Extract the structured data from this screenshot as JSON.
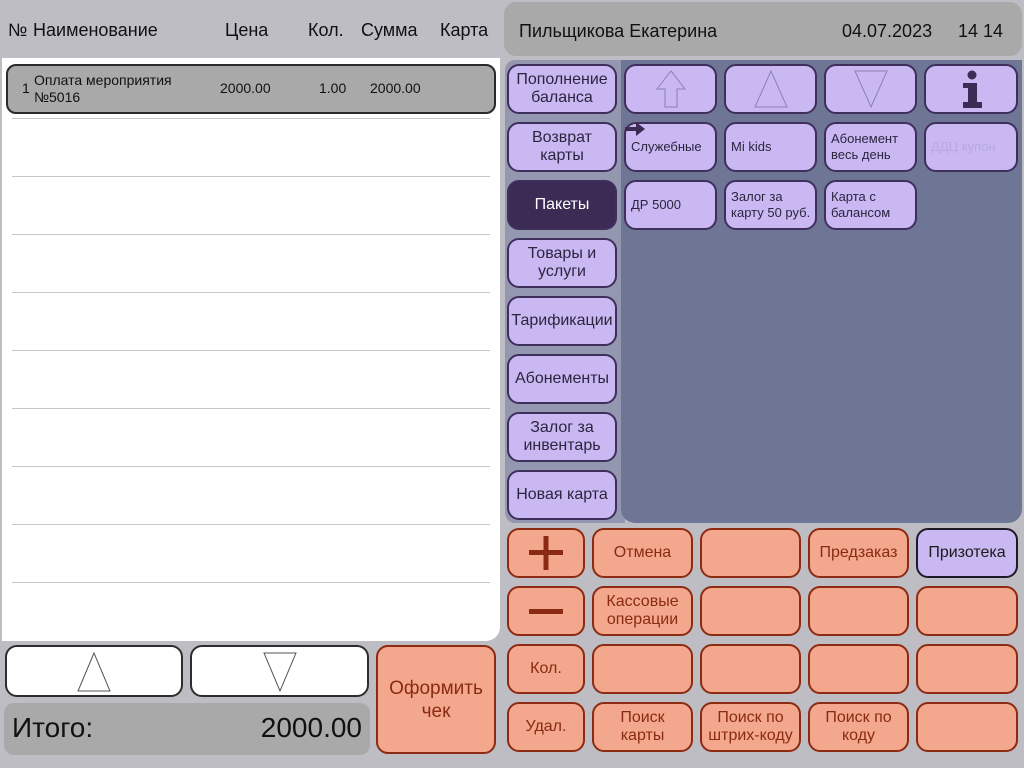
{
  "receipt": {
    "columns": [
      "№",
      "Наименование",
      "Цена",
      "Кол.",
      "Сумма",
      "Карта"
    ],
    "rows": [
      {
        "num": "1",
        "name_line1": "Оплата мероприятия",
        "name_line2": "№5016",
        "price": "2000.00",
        "qty": "1.00",
        "sum": "2000.00"
      }
    ]
  },
  "total": {
    "label": "Итого:",
    "value": "2000.00"
  },
  "checkout_label_1": "Оформить",
  "checkout_label_2": "чек",
  "header": {
    "cashier": "Пильщикова Екатерина",
    "date": "04.07.2023",
    "time": "14 14"
  },
  "categories": [
    {
      "l1": "Пополнение",
      "l2": "баланса"
    },
    {
      "l1": "Возврат",
      "l2": "карты"
    },
    {
      "l1": "Пакеты",
      "l2": ""
    },
    {
      "l1": "Товары и",
      "l2": "услуги"
    },
    {
      "l1": "Тарификации",
      "l2": ""
    },
    {
      "l1": "Абонементы",
      "l2": ""
    },
    {
      "l1": "Залог за",
      "l2": "инвентарь"
    },
    {
      "l1": "Новая карта",
      "l2": ""
    }
  ],
  "items": [
    {
      "l1": "Служебные",
      "l2": ""
    },
    {
      "l1": "Mi kids",
      "l2": ""
    },
    {
      "l1": "Абонемент",
      "l2": "весь день"
    },
    {
      "l1": "ДДЦ купон",
      "l2": ""
    },
    {
      "l1": "ДР 5000",
      "l2": ""
    },
    {
      "l1": "Залог за",
      "l2": "карту 50 руб."
    },
    {
      "l1": "Карта с",
      "l2": "балансом"
    }
  ],
  "actions": {
    "cancel": "Отмена",
    "preorder": "Предзаказ",
    "prizoteka": "Призотека",
    "cash_ops_1": "Кассовые",
    "cash_ops_2": "операции",
    "qty": "Кол.",
    "delete": "Удал.",
    "search_card_1": "Поиск",
    "search_card_2": "карты",
    "search_barcode_1": "Поиск по",
    "search_barcode_2": "штрих-коду",
    "search_code_1": "Поиск по",
    "search_code_2": "коду"
  },
  "colors": {
    "purple": "#c9b8f2",
    "purple_dark": "#3b2b55",
    "orange": "#f3a88e",
    "orange_border": "#8c2a12",
    "panel": "#6f7595"
  }
}
